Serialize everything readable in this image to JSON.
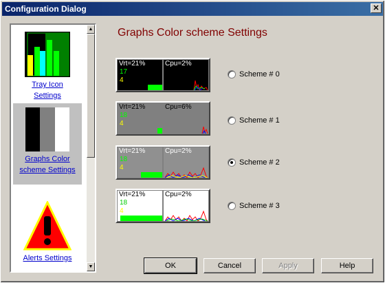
{
  "window": {
    "title": "Configuration Dialog",
    "close_glyph": "✕"
  },
  "sidebar": {
    "items": [
      {
        "label_line1": "Tray Icon",
        "label_line2": "Settings"
      },
      {
        "label_line1": "Graphs Color",
        "label_line2": "scheme Settings",
        "selected": true
      },
      {
        "label_line1": "Alerts Settings"
      }
    ],
    "scroll_up_glyph": "▲",
    "scroll_down_glyph": "▼"
  },
  "main": {
    "heading": "Graphs Color scheme Settings",
    "schemes": [
      {
        "vrt": "Vrt=21%",
        "cpu": "Cpu=2%",
        "n1": "17",
        "n2": "4",
        "label": "Scheme # 0",
        "checked": false,
        "bg": "#000000",
        "title_color": "#ffffff",
        "n1_color": "#00ff00",
        "n2_color": "#ffff00"
      },
      {
        "vrt": "Vrt=21%",
        "cpu": "Cpu=6%",
        "n1": "18",
        "n2": "4",
        "label": "Scheme # 1",
        "checked": false,
        "bg": "#808080",
        "title_color": "#000000",
        "n1_color": "#00ff00",
        "n2_color": "#ffff00"
      },
      {
        "vrt": "Vrt=21%",
        "cpu": "Cpu=2%",
        "n1": "18",
        "n2": "4",
        "label": "Scheme # 2",
        "checked": true,
        "bg": "#909090",
        "title_color": "#ffffff",
        "n1_color": "#00ff00",
        "n2_color": "#ffff00"
      },
      {
        "vrt": "Vrt=21%",
        "cpu": "Cpu=2%",
        "n1": "18",
        "n2": "4",
        "label": "Scheme # 3",
        "checked": false,
        "bg": "#ffffff",
        "title_color": "#000000",
        "n1_color": "#00cc00",
        "n2_color": "#ffff00"
      }
    ]
  },
  "buttons": {
    "ok": "OK",
    "cancel": "Cancel",
    "apply": "Apply",
    "help": "Help"
  },
  "colors": {
    "title_bar": "#0a246a",
    "heading": "#800000",
    "link": "#0000cc",
    "panel": "#d4d0c8"
  }
}
